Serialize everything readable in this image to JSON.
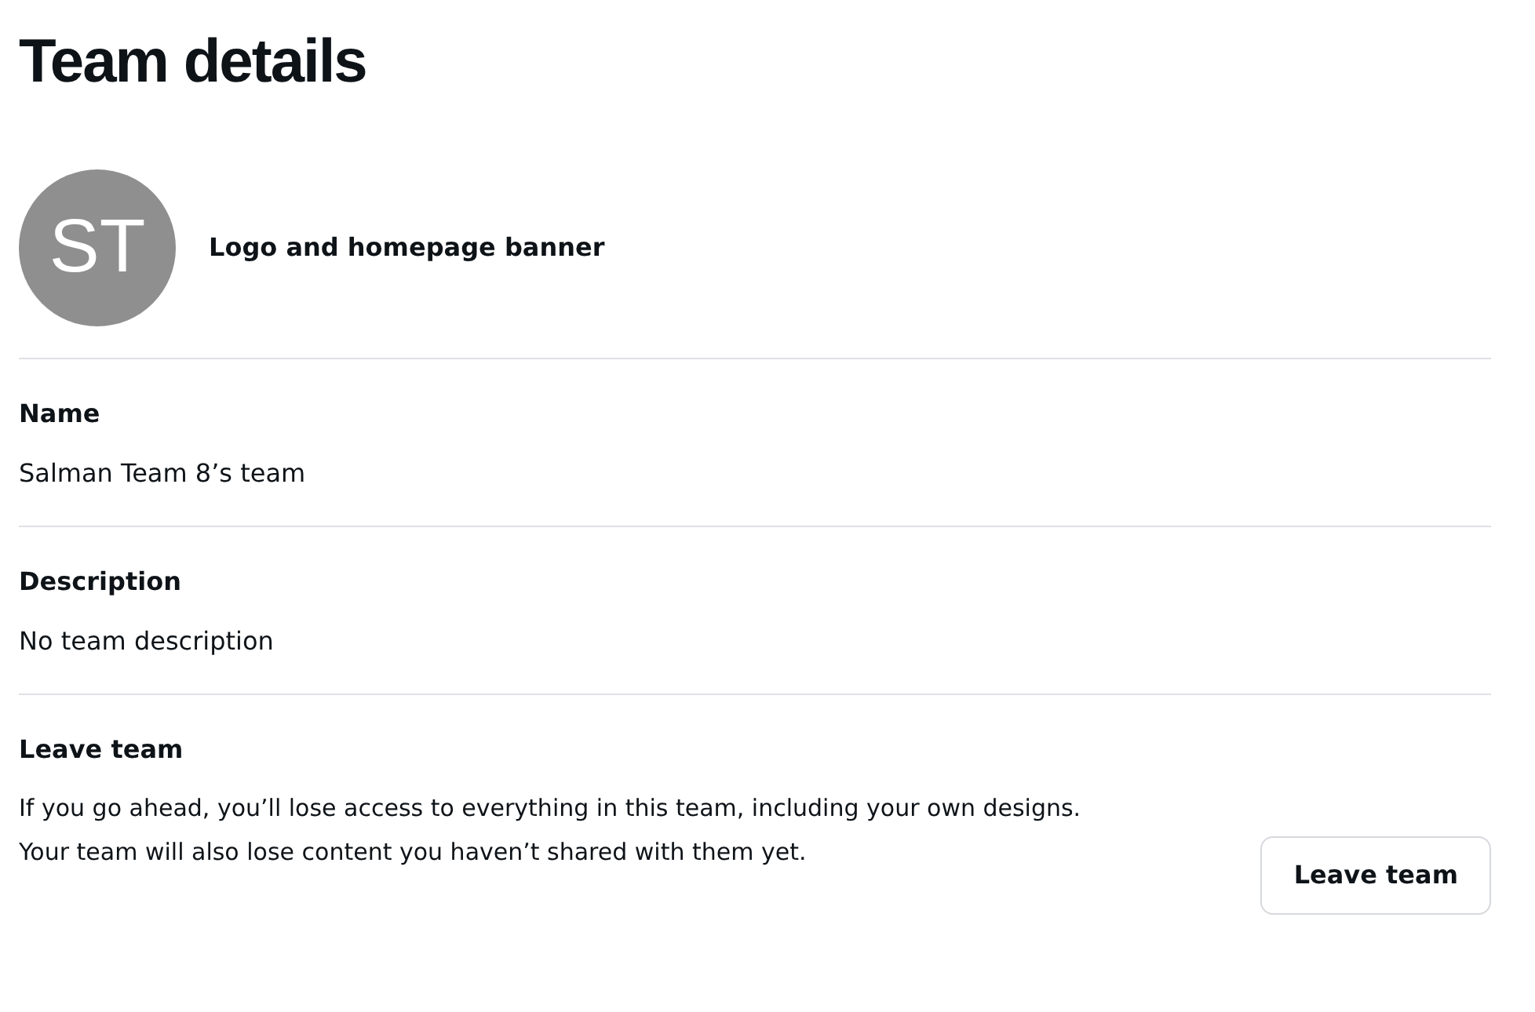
{
  "title": "Team details",
  "avatar": {
    "initials": "ST",
    "label": "Logo and homepage banner"
  },
  "fields": [
    {
      "label": "Name",
      "value": "Salman Team 8’s team"
    },
    {
      "label": "Description",
      "value": "No team description"
    }
  ],
  "leave": {
    "label": "Leave team",
    "lines": [
      "If you go ahead, you’ll lose access to everything in this team, including your own designs.",
      "Your team will also lose content you haven’t shared with them yet."
    ],
    "button": "Leave team"
  }
}
